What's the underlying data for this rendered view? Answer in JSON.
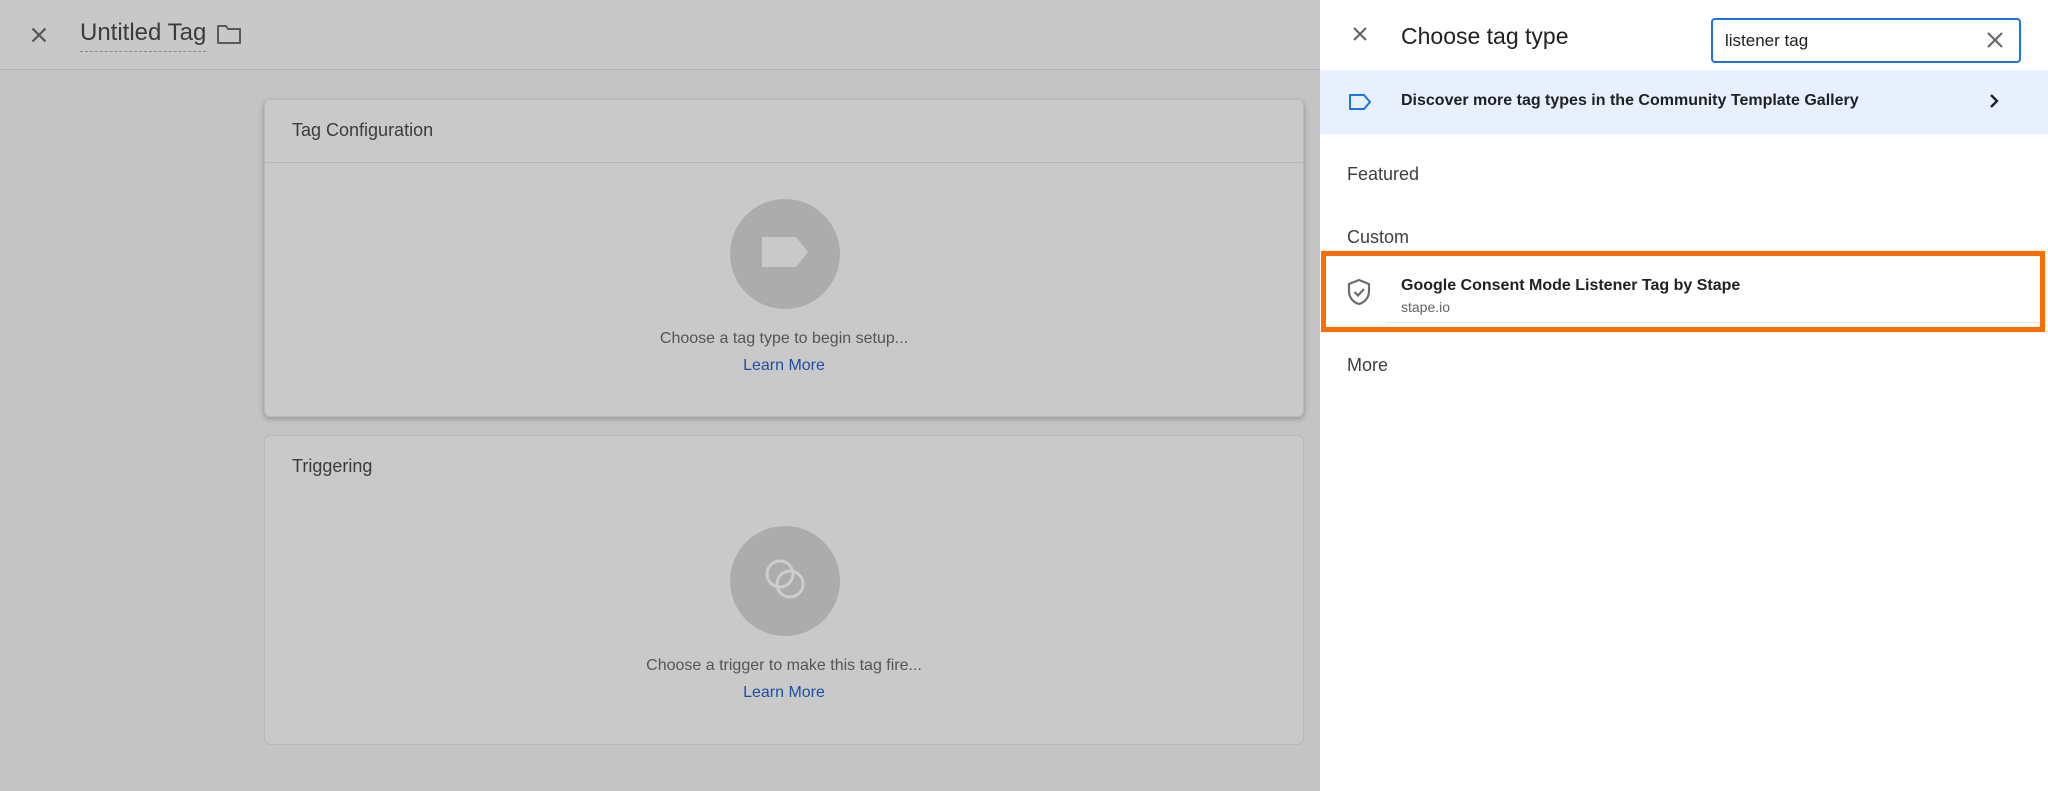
{
  "editor": {
    "title": "Untitled Tag",
    "cards": {
      "configuration": {
        "title": "Tag Configuration",
        "hint": "Choose a tag type to begin setup...",
        "link": "Learn More"
      },
      "triggering": {
        "title": "Triggering",
        "hint": "Choose a trigger to make this tag fire...",
        "link": "Learn More"
      }
    }
  },
  "panel": {
    "title": "Choose tag type",
    "search": {
      "value": "listener tag"
    },
    "discover": {
      "label": "Discover more tag types in the Community Template Gallery"
    },
    "sections": {
      "featured": "Featured",
      "custom": "Custom",
      "more": "More"
    },
    "results": [
      {
        "name": "Google Consent Mode Listener Tag by Stape",
        "source": "stape.io",
        "icon": "shield-check-icon",
        "highlighted": true
      }
    ]
  },
  "colors": {
    "accent": "#1a73e8",
    "highlight": "#ff6d00",
    "link": "#1c4fa3",
    "discover_bg": "#e8f0fe"
  }
}
